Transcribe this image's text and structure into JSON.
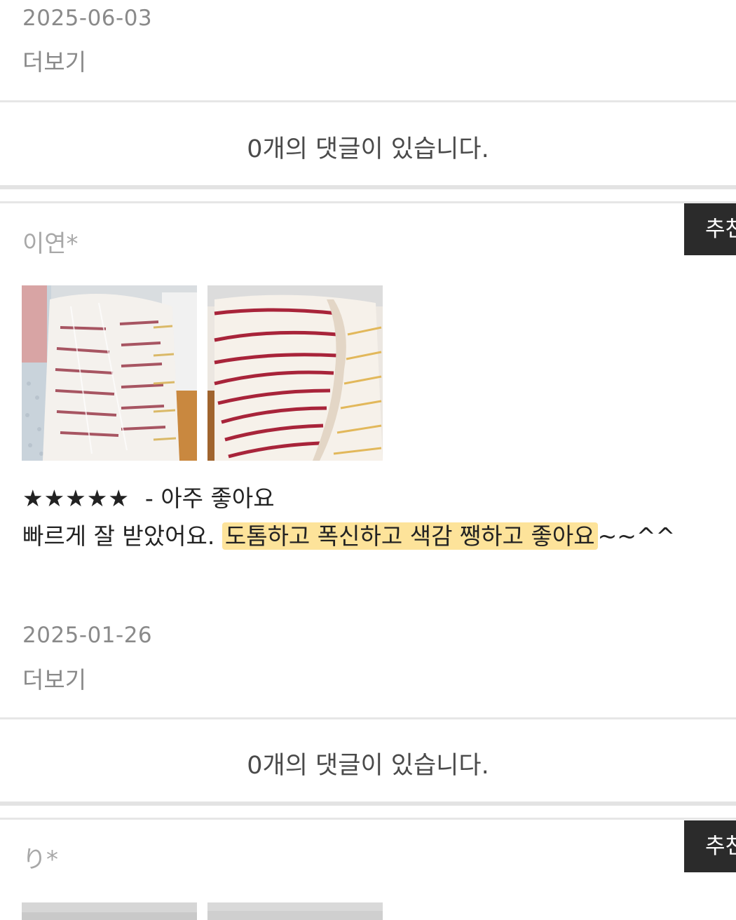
{
  "prev_review": {
    "date": "2025-06-03",
    "more_label": "더보기",
    "comments_label": "0개의 댓글이 있습니다."
  },
  "review": {
    "reviewer": "이연*",
    "recommend_label": "추천",
    "stars": "★★★★★",
    "rating_text": "- 아주 좋아요",
    "body_before": "빠르게 잘 받았어요. ",
    "body_highlight": "도톰하고 폭신하고 색감 쨍하고 좋아요",
    "body_after": "~~^^",
    "highlight_color": "#fde39a",
    "date": "2025-01-26",
    "more_label": "더보기",
    "comments_label": "0개의 댓글이 있습니다."
  },
  "next_review": {
    "reviewer": "り*",
    "recommend_label": "추천"
  }
}
